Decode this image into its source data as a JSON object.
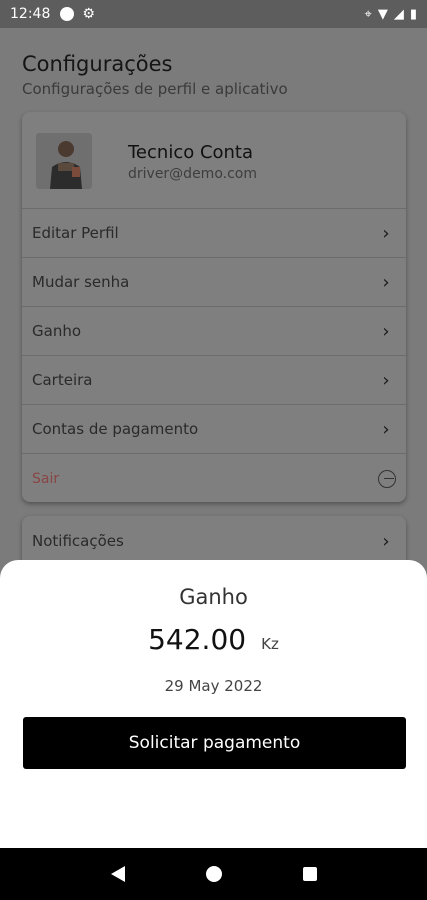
{
  "status_bar": {
    "time": "12:48",
    "icons": [
      "circle-icon",
      "gear-icon",
      "location-icon",
      "wifi-icon",
      "signal-icon",
      "battery-icon"
    ]
  },
  "page": {
    "title": "Configurações",
    "subtitle": "Configurações de perfil e aplicativo"
  },
  "profile": {
    "name": "Tecnico Conta",
    "email": "driver@demo.com"
  },
  "menu": [
    {
      "label": "Editar Perfil"
    },
    {
      "label": "Mudar senha"
    },
    {
      "label": "Ganho"
    },
    {
      "label": "Carteira"
    },
    {
      "label": "Contas de pagamento"
    }
  ],
  "logout": {
    "label": "Sair",
    "color": "#8a4545"
  },
  "second_card": {
    "label": "Notificações"
  },
  "sheet": {
    "title": "Ganho",
    "amount": "542.00",
    "currency": "Kz",
    "date": "29 May 2022",
    "button_label": "Solicitar pagamento"
  },
  "colors": {
    "scrim": "#7b7b7b",
    "button_bg": "#000000",
    "sheet_bg": "#ffffff"
  }
}
